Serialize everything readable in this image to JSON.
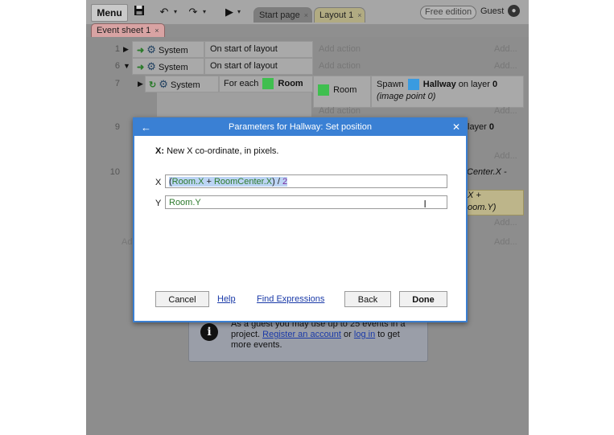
{
  "toolbar": {
    "menu_label": "Menu",
    "save_icon": "floppy-disk-icon",
    "undo_icon": "undo-icon",
    "redo_icon": "redo-icon",
    "play_icon": "play-icon"
  },
  "tabs": [
    {
      "label": "Start page",
      "close": "×"
    },
    {
      "label": "Layout 1",
      "close": "×"
    }
  ],
  "edition_badge": "Free edition",
  "guest_label": "Guest",
  "sheet_tab": {
    "label": "Event sheet 1",
    "close": "×"
  },
  "events": {
    "row1": {
      "num": "1",
      "object": "System",
      "condition": "On start of layout",
      "add_action": "Add action",
      "add": "Add..."
    },
    "row6": {
      "num": "6",
      "object": "System",
      "condition": "On start of layout",
      "add_action": "Add action",
      "add": "Add..."
    },
    "row7": {
      "num": "7",
      "object": "System",
      "condition_prefix": "For each",
      "condition_object": "Room",
      "action_object": "Room",
      "action_prefix": "Spawn",
      "action_target": "Hallway",
      "action_layer_text": "on layer",
      "action_layer": "0",
      "action_point": "(image point 0)",
      "add_action": "Add action",
      "add": "Add..."
    },
    "row9": {
      "num": "9",
      "layer_text": "layer",
      "layer": "0",
      "add": "Add..."
    },
    "row10": {
      "num": "10",
      "expr_part1": "Center.X -",
      "expr_part2": "X +",
      "expr_part3": "oom.Y)",
      "add1": "Add...",
      "add2": "Add..."
    },
    "add_event_partial": "Add"
  },
  "info_box": {
    "text_1": "As a guest you may use up to 25 events in a project.",
    "link_register": "Register an account",
    "text_or": "or",
    "link_login": "log in",
    "text_2": "to get more events."
  },
  "dialog": {
    "title": "Parameters for Hallway: Set position",
    "back_icon": "back-arrow-icon",
    "close_icon": "close-icon",
    "desc_bold": "X:",
    "desc_text": "New X co-ordinate, in pixels.",
    "x_label": "X",
    "x_value": {
      "open": "(",
      "obj1": "Room.X",
      "plus": " + ",
      "obj2": "RoomCenter.X",
      "close": ") / ",
      "num": "2"
    },
    "y_label": "Y",
    "y_value": "Room.Y",
    "buttons": {
      "cancel": "Cancel",
      "help": "Help",
      "find": "Find Expressions",
      "back": "Back",
      "done": "Done"
    }
  },
  "colors": {
    "dialog_accent": "#3a80d4",
    "room_swatch": "#3fbf4f",
    "hallway_swatch": "#3a9be0",
    "link": "#1a3aa8"
  }
}
